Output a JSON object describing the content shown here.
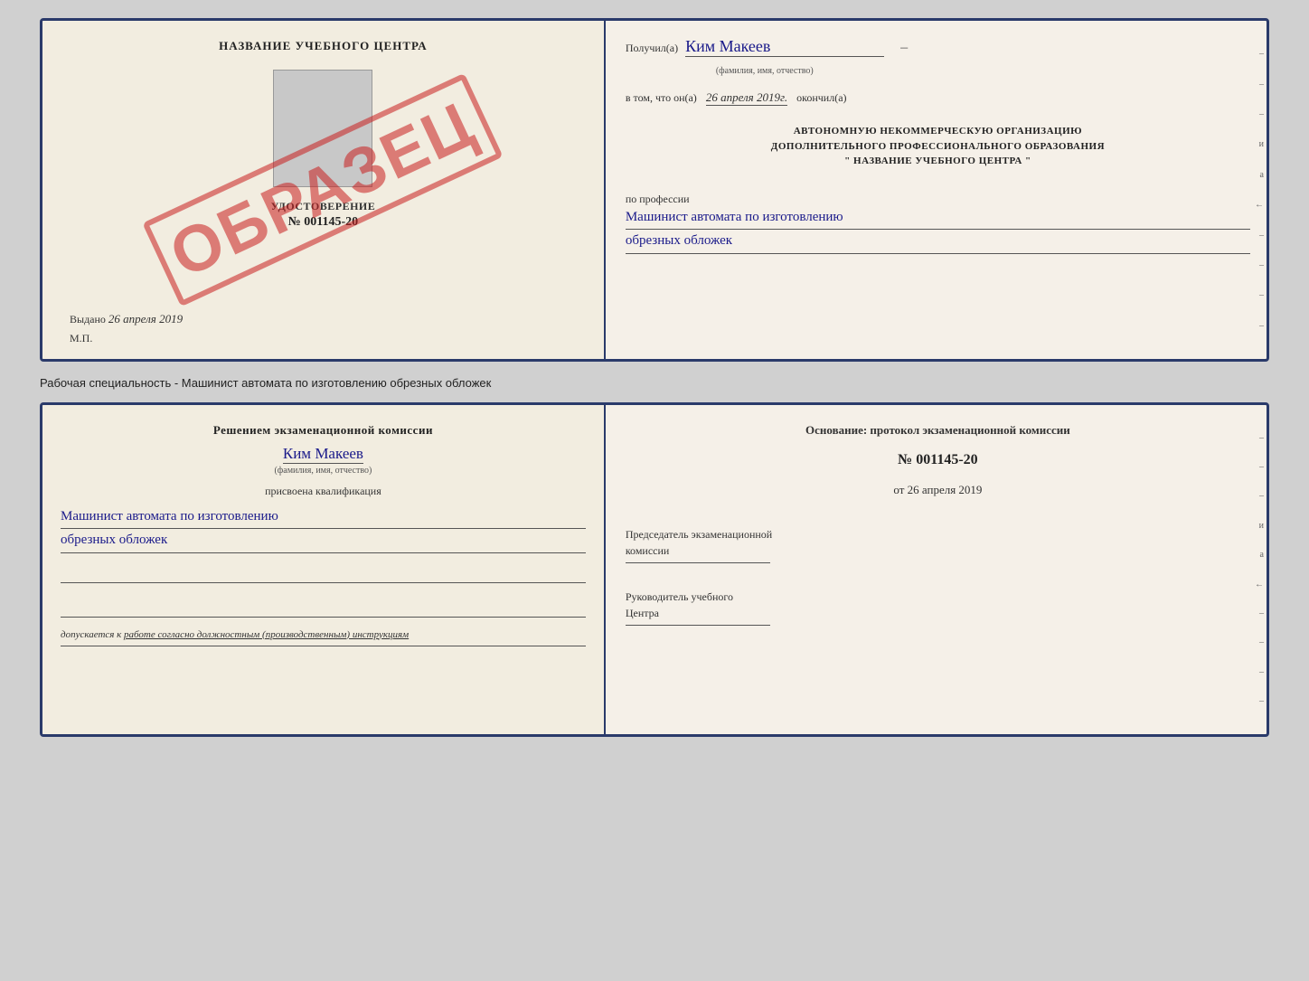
{
  "cert": {
    "left": {
      "title": "НАЗВАНИЕ УЧЕБНОГО ЦЕНТРА",
      "doc_title": "УДОСТОВЕРЕНИЕ",
      "number": "№ 001145-20",
      "issued_label": "Выдано",
      "issued_date": "26 апреля 2019",
      "mp": "М.П.",
      "stamp": "ОБРАЗЕЦ"
    },
    "right": {
      "received_label": "Получил(а)",
      "recipient_name": "Ким Макеев",
      "name_sublabel": "(фамилия, имя, отчество)",
      "in_that_label": "в том, что он(а)",
      "completion_date": "26 апреля 2019г.",
      "completed_label": "окончил(а)",
      "org_line1": "АВТОНОМНУЮ НЕКОММЕРЧЕСКУЮ ОРГАНИЗАЦИЮ",
      "org_line2": "ДОПОЛНИТЕЛЬНОГО ПРОФЕССИОНАЛЬНОГО ОБРАЗОВАНИЯ",
      "org_line3": "\"  НАЗВАНИЕ УЧЕБНОГО ЦЕНТРА  \"",
      "profession_label": "по профессии",
      "profession_handwritten1": "Машинист автомата по изготовлению",
      "profession_handwritten2": "обрезных обложек"
    }
  },
  "middle_caption": "Рабочая специальность - Машинист автомата по изготовлению обрезных обложек",
  "qual": {
    "left": {
      "decision_text1": "Решением экзаменационной комиссии",
      "applicant_name": "Ким Макеев",
      "name_sublabel": "(фамилия, имя, отчество)",
      "assigned_text": "присвоена квалификация",
      "qual_handwritten1": "Машинист автомата по изготовлению",
      "qual_handwritten2": "обрезных обложек",
      "admission_prefix": "допускается к",
      "admission_underlined": "работе согласно должностным (производственным) инструкциям"
    },
    "right": {
      "basis_text": "Основание: протокол экзаменационной комиссии",
      "protocol_number": "№ 001145-20",
      "date_prefix": "от",
      "protocol_date": "26 апреля 2019",
      "chairman_label_line1": "Председатель экзаменационной",
      "chairman_label_line2": "комиссии",
      "director_label_line1": "Руководитель учебного",
      "director_label_line2": "Центра"
    }
  },
  "right_edge": {
    "dashes": [
      "–",
      "–",
      "–",
      "и",
      "а",
      "←",
      "–",
      "–",
      "–",
      "–"
    ]
  }
}
